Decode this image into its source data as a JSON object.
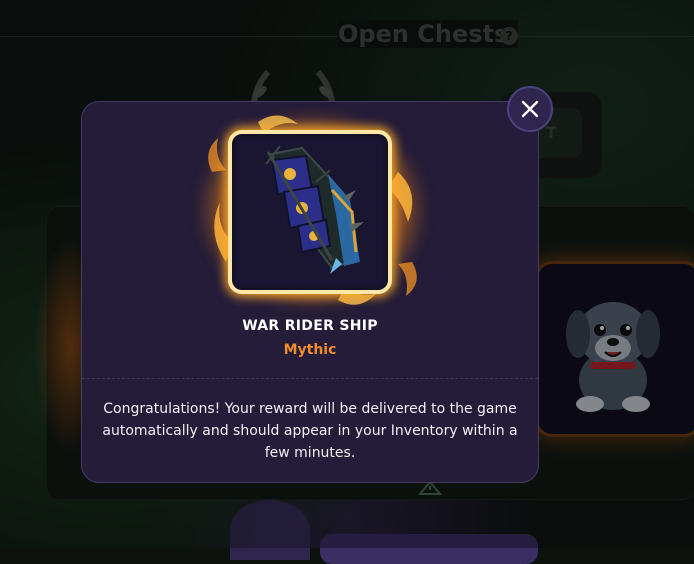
{
  "background": {
    "title": "Open Chests",
    "help_icon": "?",
    "button_fragment": "T"
  },
  "modal": {
    "close_icon": "close-icon",
    "item": {
      "name": "WAR RIDER SHIP",
      "rarity": "Mythic",
      "icon": "war-rider-ship-icon"
    },
    "message": "Congratulations! Your reward will be delivered to the game automatically and should appear in your Inventory within a few minutes."
  },
  "colors": {
    "modal_bg": "#241c38",
    "rarity_mythic": "#f08c2a",
    "frame_glow": "#ffb02a",
    "accent_purple": "#4c4180"
  }
}
